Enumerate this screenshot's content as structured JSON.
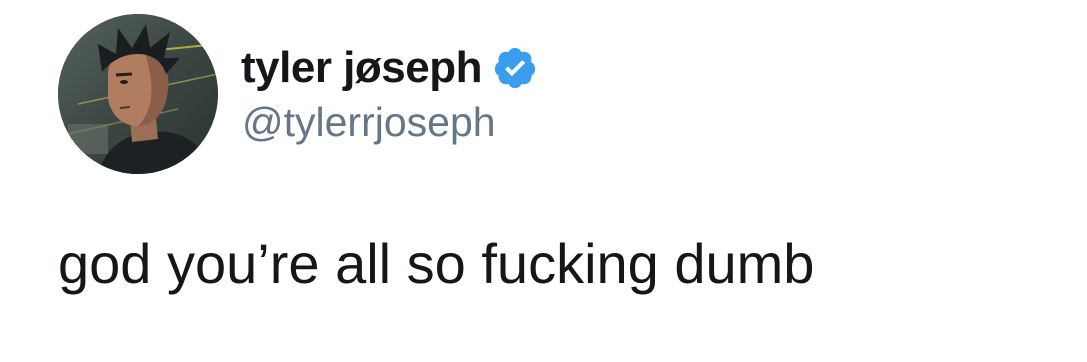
{
  "tweet": {
    "author": {
      "display_name": "tyler jøseph",
      "handle": "@tylerrjoseph",
      "verified": true,
      "verified_icon": "verified-badge-icon",
      "verified_color": "#3a9ef0"
    },
    "text": "god you’re all so fucking dumb"
  }
}
